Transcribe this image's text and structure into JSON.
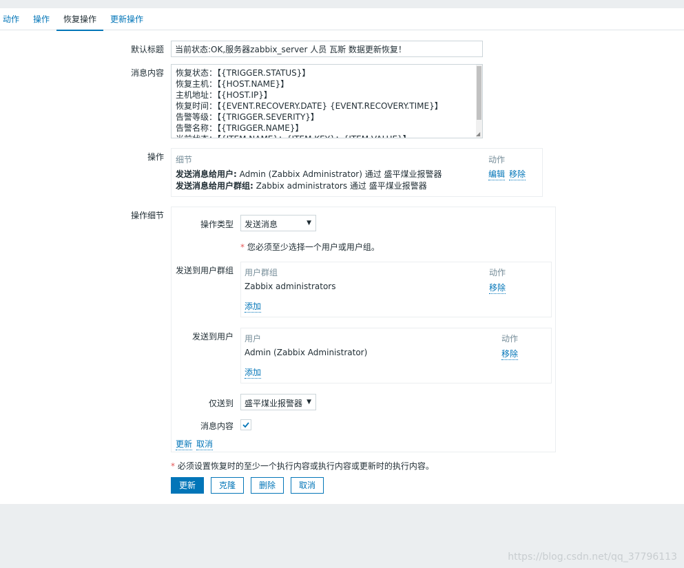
{
  "tabs": [
    {
      "label": "动作"
    },
    {
      "label": "操作"
    },
    {
      "label": "恢复操作"
    },
    {
      "label": "更新操作"
    }
  ],
  "form": {
    "default_subject_label": "默认标题",
    "default_subject_value": "当前状态:OK,服务器zabbix_server 人员 瓦斯 数据更新恢复！",
    "message_label": "消息内容",
    "message_lines": [
      "恢复状态：【{TRIGGER.STATUS}】",
      "恢复主机：【{HOST.NAME}】",
      "主机地址：【{HOST.IP}】",
      "恢复时间：【{EVENT.RECOVERY.DATE} {EVENT.RECOVERY.TIME}】",
      "告警等级：【{TRIGGER.SEVERITY}】",
      "告警名称：【{TRIGGER.NAME}】",
      "当前状态：【{ITEM.NAME}：{ITEM.KEY}：{ITEM.VALUE}】"
    ],
    "operations_label": "操作",
    "operations_table": {
      "col_details": "细节",
      "col_action": "动作",
      "row1_bold": "发送消息给用户:",
      "row1_text": " Admin (Zabbix Administrator) 通过 盛平煤业报警器",
      "row2_bold": "发送消息给用户群组:",
      "row2_text": " Zabbix administrators 通过 盛平煤业报警器",
      "edit_link": "编辑",
      "remove_link": "移除"
    },
    "op_details_label": "操作细节",
    "op_details": {
      "op_type_label": "操作类型",
      "op_type_value": "发送消息",
      "required_note": "您必须至少选择一个用户或用户组。",
      "send_to_groups_label": "发送到用户群组",
      "groups_table": {
        "col_group": "用户群组",
        "col_action": "动作",
        "row": "Zabbix administrators",
        "remove": "移除",
        "add": "添加"
      },
      "send_to_users_label": "发送到用户",
      "users_table": {
        "col_user": "用户",
        "col_action": "动作",
        "row": "Admin (Zabbix Administrator)",
        "remove": "移除",
        "add": "添加"
      },
      "send_only_to_label": "仅送到",
      "send_only_to_value": "盛平煤业报警器",
      "message_content_label": "消息内容",
      "message_content_checked": true,
      "update_link": "更新",
      "cancel_link": "取消"
    },
    "bottom_required_note": "必须设置恢复时的至少一个执行内容或执行内容或更新时的执行内容。",
    "buttons": {
      "update": "更新",
      "clone": "克隆",
      "delete": "删除",
      "cancel": "取消"
    }
  },
  "watermark": "https://blog.csdn.net/qq_37796113",
  "colors": {
    "accent": "#0275b8",
    "required": "#e45959",
    "background": "#ebeef0"
  }
}
